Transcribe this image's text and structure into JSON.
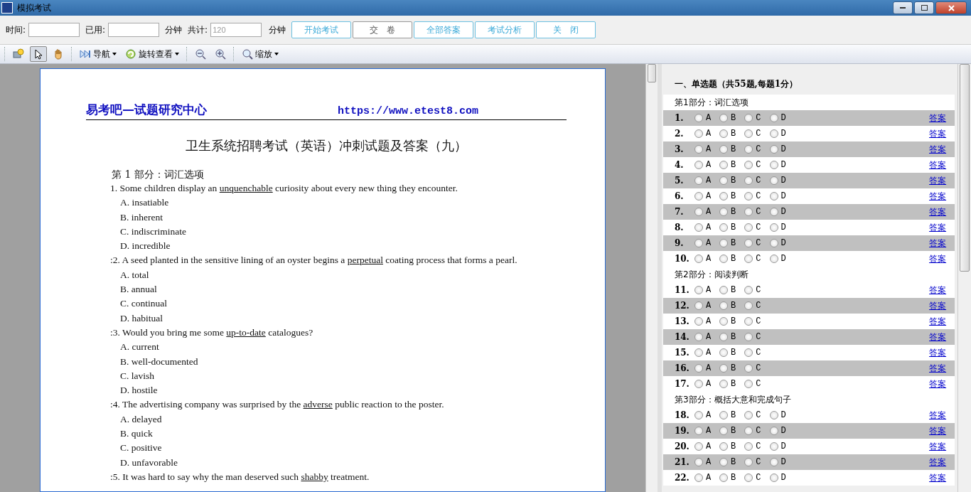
{
  "window": {
    "title": "模拟考试"
  },
  "exam_bar": {
    "time_label": "时间:",
    "used_label": "已用:",
    "unit_1": "分钟",
    "total_label": "共计:",
    "total_placeholder": "120",
    "unit_2": "分钟",
    "buttons": [
      {
        "label": "开始考试",
        "disabled": false
      },
      {
        "label": "交　卷",
        "disabled": true
      },
      {
        "label": "全部答案",
        "disabled": false
      },
      {
        "label": "考试分析",
        "disabled": false
      },
      {
        "label": "关　闭",
        "disabled": false
      }
    ]
  },
  "viewer_toolbar": {
    "items": [
      {
        "kind": "icon",
        "selected": false
      },
      {
        "kind": "icon",
        "selected": true
      },
      {
        "kind": "icon",
        "selected": false
      },
      {
        "kind": "menu",
        "label": "导航"
      },
      {
        "kind": "menu",
        "label": "旋转查看"
      },
      {
        "kind": "icon",
        "selected": false
      },
      {
        "kind": "icon",
        "selected": false
      },
      {
        "kind": "menu",
        "label": "缩放"
      }
    ]
  },
  "document": {
    "site": "易考吧—试题研究中心",
    "url": "https://www.etest8.com",
    "title": "卫生系统招聘考试（英语）冲刺试题及答案（九）",
    "part": "第 1 部分：词汇选项",
    "questions": [
      {
        "number": "1.",
        "before": "Some children display an ",
        "underlined": "unquenchable",
        "after": " curiosity about every new thing they encounter.",
        "options": [
          "A. insatiable",
          "B. inherent",
          "C. indiscriminate",
          "D. incredible"
        ]
      },
      {
        "number": ":2.",
        "before": "A seed planted in the sensitive lining of an oyster begins a ",
        "underlined": "perpetual",
        "after": " coating process that forms a pearl.",
        "options": [
          "A. total",
          "B. annual",
          "C. continual",
          "D. habitual"
        ]
      },
      {
        "number": ":3.",
        "before": "Would you bring me some ",
        "underlined": "up-to-date",
        "after": " catalogues?",
        "options": [
          "A. current",
          "B. well-documented",
          "C. lavish",
          "D. hostile"
        ]
      },
      {
        "number": ":4.",
        "before": "The advertising company was surprised by the ",
        "underlined": "adverse",
        "after": " public reaction to the poster.",
        "options": [
          "A. delayed",
          "B. quick",
          "C. positive",
          "D. unfavorable"
        ]
      },
      {
        "number": ":5.",
        "before": "It was hard to say why the man deserved such ",
        "underlined": "shabby",
        "after": " treatment."
      }
    ]
  },
  "answer_panel": {
    "heading": "一、单选题（共55题,每题1分）",
    "parts": [
      {
        "title": "第1部分：词汇选项",
        "rows": [
          {
            "number": "1.",
            "link": "答案",
            "shaded": true,
            "options": [
              {
                "label": "A",
                "selected": false
              },
              {
                "label": "B",
                "selected": false
              },
              {
                "label": "C",
                "selected": false
              },
              {
                "label": "D",
                "selected": false
              }
            ]
          },
          {
            "number": "2.",
            "link": "答案",
            "shaded": false,
            "options": [
              {
                "label": "A",
                "selected": false
              },
              {
                "label": "B",
                "selected": false
              },
              {
                "label": "C",
                "selected": false
              },
              {
                "label": "D",
                "selected": false
              }
            ]
          },
          {
            "number": "3.",
            "link": "答案",
            "shaded": true,
            "options": [
              {
                "label": "A",
                "selected": false
              },
              {
                "label": "B",
                "selected": false
              },
              {
                "label": "C",
                "selected": false
              },
              {
                "label": "D",
                "selected": false
              }
            ]
          },
          {
            "number": "4.",
            "link": "答案",
            "shaded": false,
            "options": [
              {
                "label": "A",
                "selected": false
              },
              {
                "label": "B",
                "selected": false
              },
              {
                "label": "C",
                "selected": false
              },
              {
                "label": "D",
                "selected": false
              }
            ]
          },
          {
            "number": "5.",
            "link": "答案",
            "shaded": true,
            "options": [
              {
                "label": "A",
                "selected": false
              },
              {
                "label": "B",
                "selected": false
              },
              {
                "label": "C",
                "selected": false
              },
              {
                "label": "D",
                "selected": false
              }
            ]
          },
          {
            "number": "6.",
            "link": "答案",
            "shaded": false,
            "options": [
              {
                "label": "A",
                "selected": false
              },
              {
                "label": "B",
                "selected": false
              },
              {
                "label": "C",
                "selected": false
              },
              {
                "label": "D",
                "selected": false
              }
            ]
          },
          {
            "number": "7.",
            "link": "答案",
            "shaded": true,
            "options": [
              {
                "label": "A",
                "selected": false
              },
              {
                "label": "B",
                "selected": false
              },
              {
                "label": "C",
                "selected": false
              },
              {
                "label": "D",
                "selected": false
              }
            ]
          },
          {
            "number": "8.",
            "link": "答案",
            "shaded": false,
            "options": [
              {
                "label": "A",
                "selected": false
              },
              {
                "label": "B",
                "selected": false
              },
              {
                "label": "C",
                "selected": false
              },
              {
                "label": "D",
                "selected": false
              }
            ]
          },
          {
            "number": "9.",
            "link": "答案",
            "shaded": true,
            "options": [
              {
                "label": "A",
                "selected": false
              },
              {
                "label": "B",
                "selected": false
              },
              {
                "label": "C",
                "selected": false
              },
              {
                "label": "D",
                "selected": false
              }
            ]
          },
          {
            "number": "10.",
            "link": "答案",
            "shaded": false,
            "options": [
              {
                "label": "A",
                "selected": false
              },
              {
                "label": "B",
                "selected": false
              },
              {
                "label": "C",
                "selected": false
              },
              {
                "label": "D",
                "selected": false
              }
            ]
          }
        ]
      },
      {
        "title": "第2部分：阅读判断",
        "rows": [
          {
            "number": "11.",
            "link": "答案",
            "shaded": false,
            "options": [
              {
                "label": "A",
                "selected": false
              },
              {
                "label": "B",
                "selected": false
              },
              {
                "label": "C",
                "selected": false
              }
            ]
          },
          {
            "number": "12.",
            "link": "答案",
            "shaded": true,
            "options": [
              {
                "label": "A",
                "selected": false
              },
              {
                "label": "B",
                "selected": false
              },
              {
                "label": "C",
                "selected": false
              }
            ]
          },
          {
            "number": "13.",
            "link": "答案",
            "shaded": false,
            "options": [
              {
                "label": "A",
                "selected": false
              },
              {
                "label": "B",
                "selected": false
              },
              {
                "label": "C",
                "selected": false
              }
            ]
          },
          {
            "number": "14.",
            "link": "答案",
            "shaded": true,
            "options": [
              {
                "label": "A",
                "selected": false
              },
              {
                "label": "B",
                "selected": false
              },
              {
                "label": "C",
                "selected": false
              }
            ]
          },
          {
            "number": "15.",
            "link": "答案",
            "shaded": false,
            "options": [
              {
                "label": "A",
                "selected": false
              },
              {
                "label": "B",
                "selected": false
              },
              {
                "label": "C",
                "selected": false
              }
            ]
          },
          {
            "number": "16.",
            "link": "答案",
            "shaded": true,
            "options": [
              {
                "label": "A",
                "selected": false
              },
              {
                "label": "B",
                "selected": false
              },
              {
                "label": "C",
                "selected": false
              }
            ]
          },
          {
            "number": "17.",
            "link": "答案",
            "shaded": false,
            "options": [
              {
                "label": "A",
                "selected": false
              },
              {
                "label": "B",
                "selected": false
              },
              {
                "label": "C",
                "selected": false
              }
            ]
          }
        ]
      },
      {
        "title": "第3部分：概括大意和完成句子",
        "rows": [
          {
            "number": "18.",
            "link": "答案",
            "shaded": false,
            "options": [
              {
                "label": "A",
                "selected": false
              },
              {
                "label": "B",
                "selected": false
              },
              {
                "label": "C",
                "selected": false
              },
              {
                "label": "D",
                "selected": false
              }
            ]
          },
          {
            "number": "19.",
            "link": "答案",
            "shaded": true,
            "options": [
              {
                "label": "A",
                "selected": false
              },
              {
                "label": "B",
                "selected": false
              },
              {
                "label": "C",
                "selected": false
              },
              {
                "label": "D",
                "selected": false
              }
            ]
          },
          {
            "number": "20.",
            "link": "答案",
            "shaded": false,
            "options": [
              {
                "label": "A",
                "selected": false
              },
              {
                "label": "B",
                "selected": false
              },
              {
                "label": "C",
                "selected": false
              },
              {
                "label": "D",
                "selected": false
              }
            ]
          },
          {
            "number": "21.",
            "link": "答案",
            "shaded": true,
            "options": [
              {
                "label": "A",
                "selected": false
              },
              {
                "label": "B",
                "selected": false
              },
              {
                "label": "C",
                "selected": false
              },
              {
                "label": "D",
                "selected": false
              }
            ]
          },
          {
            "number": "22.",
            "link": "答案",
            "shaded": false,
            "options": [
              {
                "label": "A",
                "selected": false
              },
              {
                "label": "B",
                "selected": false
              },
              {
                "label": "C",
                "selected": false
              },
              {
                "label": "D",
                "selected": false
              }
            ]
          }
        ]
      }
    ]
  }
}
